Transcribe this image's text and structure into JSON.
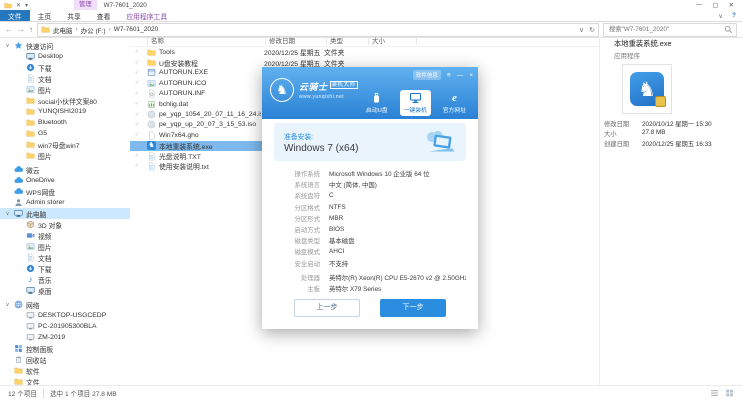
{
  "colors": {
    "accent": "#2b8de0",
    "dialog_header_top": "#60b1ef",
    "dialog_header_bottom": "#2a81d5",
    "selection_row": "#7db9ec",
    "sidebar_selection": "#cce8ff",
    "context_tab": "#f0defa",
    "folder": "#fdd36a"
  },
  "titlebar": {
    "title": "W7-7601_2020",
    "context_label": "管理",
    "controls": {
      "minimize": "—",
      "maximize": "▢",
      "close": "✕"
    }
  },
  "ribbon": {
    "tabs": [
      {
        "label": "文件",
        "style": "file"
      },
      {
        "label": "主页"
      },
      {
        "label": "共享"
      },
      {
        "label": "查看"
      },
      {
        "label": "应用程序工具",
        "style": "ctx"
      }
    ],
    "expand_glyph": "∨",
    "help_glyph": "?"
  },
  "address": {
    "back": "←",
    "forward": "→",
    "up": "↑",
    "refresh": "↻",
    "dropdown": "∨",
    "breadcrumb": [
      "此电脑",
      "办公 (F:)",
      "W7-7601_2020"
    ],
    "search_placeholder": "搜索\"W7-7601_2020\""
  },
  "sidebar": {
    "items": [
      {
        "label": "快速访问",
        "icon": "star",
        "depth": 0,
        "arrow": "expanded"
      },
      {
        "label": "Desktop",
        "icon": "monitor",
        "depth": 1
      },
      {
        "label": "下载",
        "icon": "download",
        "depth": 1
      },
      {
        "label": "文档",
        "icon": "doc",
        "depth": 1
      },
      {
        "label": "图片",
        "icon": "picture",
        "depth": 1
      },
      {
        "label": "social小伙伴文案80",
        "icon": "folder",
        "depth": 1
      },
      {
        "label": "YUNQISHI2019",
        "icon": "folder",
        "depth": 1
      },
      {
        "label": "Bluetooth",
        "icon": "folder",
        "depth": 1
      },
      {
        "label": "G5",
        "icon": "folder",
        "depth": 1
      },
      {
        "label": "win7母盘win7",
        "icon": "folder",
        "depth": 1
      },
      {
        "label": "图片",
        "icon": "folder",
        "depth": 1
      },
      {
        "label": "微云",
        "icon": "cloud",
        "depth": 0,
        "gap": true
      },
      {
        "label": "OneDrive",
        "icon": "cloud",
        "depth": 0
      },
      {
        "label": "WPS网盘",
        "icon": "cloud",
        "depth": 0
      },
      {
        "label": "Admin storer",
        "icon": "person",
        "depth": 0
      },
      {
        "label": "此电脑",
        "icon": "monitor",
        "depth": 0,
        "arrow": "expanded",
        "selected": true
      },
      {
        "label": "3D 对象",
        "icon": "cube",
        "depth": 1
      },
      {
        "label": "视频",
        "icon": "video",
        "depth": 1
      },
      {
        "label": "图片",
        "icon": "picture",
        "depth": 1
      },
      {
        "label": "文档",
        "icon": "doc",
        "depth": 1
      },
      {
        "label": "下载",
        "icon": "download",
        "depth": 1
      },
      {
        "label": "音乐",
        "icon": "music",
        "depth": 1
      },
      {
        "label": "桌面",
        "icon": "monitor",
        "depth": 1
      },
      {
        "label": "网络",
        "icon": "globe",
        "depth": 0,
        "arrow": "expanded",
        "gap": true
      },
      {
        "label": "DESKTOP-USGCEDP",
        "icon": "pc",
        "depth": 1
      },
      {
        "label": "PC-201905300BLA",
        "icon": "pc",
        "depth": 1
      },
      {
        "label": "ZM-2019",
        "icon": "pc",
        "depth": 1
      },
      {
        "label": "控制面板",
        "icon": "control",
        "depth": 0
      },
      {
        "label": "回收站",
        "icon": "trash",
        "depth": 0
      },
      {
        "label": "软件",
        "icon": "folder",
        "depth": 0
      },
      {
        "label": "文件",
        "icon": "folder",
        "depth": 0
      }
    ]
  },
  "file_list": {
    "columns": [
      "名称",
      "修改日期",
      "类型",
      "大小"
    ],
    "rows": [
      {
        "name": "Tools",
        "icon": "folder",
        "date": "2020/12/25 星期五 1...",
        "type": "文件夹",
        "size": ""
      },
      {
        "name": "U盘安装教程",
        "icon": "folder",
        "date": "2020/12/25 星期五 1...",
        "type": "文件夹",
        "size": ""
      },
      {
        "name": "AUTORUN.EXE",
        "icon": "app",
        "date": "",
        "type": "",
        "size": ""
      },
      {
        "name": "AUTORUN.ICO",
        "icon": "picture",
        "date": "",
        "type": "",
        "size": ""
      },
      {
        "name": "AUTORUN.INF",
        "icon": "inf",
        "date": "",
        "type": "",
        "size": ""
      },
      {
        "name": "bchlig.dat",
        "icon": "dat",
        "date": "",
        "type": "",
        "size": ""
      },
      {
        "name": "pe_yqp_1054_20_07_11_16_24.iso",
        "icon": "disc",
        "date": "",
        "type": "",
        "size": ""
      },
      {
        "name": "pe_yqp_up_20_07_3_15_53.iso",
        "icon": "disc",
        "date": "",
        "type": "",
        "size": ""
      },
      {
        "name": "Win7x64.gho",
        "icon": "page",
        "date": "",
        "type": "",
        "size": ""
      },
      {
        "name": "本地重装系统.exe",
        "icon": "knight",
        "date": "",
        "type": "",
        "size": "",
        "selected": true
      },
      {
        "name": "光盘说明.TXT",
        "icon": "doc",
        "date": "",
        "type": "",
        "size": ""
      },
      {
        "name": "使用安装说明.txt",
        "icon": "doc",
        "date": "",
        "type": "",
        "size": ""
      }
    ]
  },
  "details": {
    "filename": "本地重装系统.exe",
    "filetype": "应用程序",
    "rows": [
      {
        "label": "修改日期",
        "value": "2020/10/12 星期一 15:30"
      },
      {
        "label": "大小",
        "value": "27.8 MB"
      },
      {
        "label": "创建日期",
        "value": "2020/12/25 星期五 16:33"
      }
    ]
  },
  "dialog": {
    "logo": {
      "name": "云骑士",
      "suffix": "装机大师",
      "url": "www.yunqishi.net"
    },
    "info_button": "软件信息",
    "controls": {
      "menu": "≡",
      "minimize": "—",
      "close": "×"
    },
    "nav": [
      {
        "label": "启动U盘",
        "icon": "usb"
      },
      {
        "label": "一键装机",
        "icon": "machine",
        "active": true
      },
      {
        "label": "官方网址",
        "icon": "ie"
      }
    ],
    "card": {
      "title": "准备安装:",
      "os": "Windows 7 (x64)"
    },
    "specs": [
      {
        "label": "操作系统",
        "value": "Microsoft Windows 10 企业版 64 位"
      },
      {
        "label": "系统语言",
        "value": "中文 (简体, 中国)"
      },
      {
        "label": "系统盘符",
        "value": "C"
      },
      {
        "label": "分区格式",
        "value": "NTFS"
      },
      {
        "label": "分区形式",
        "value": "MBR"
      },
      {
        "label": "启动方式",
        "value": "BIOS"
      },
      {
        "label": "磁盘类型",
        "value": "基本磁盘"
      },
      {
        "label": "磁盘模式",
        "value": "AHCI"
      },
      {
        "label": "安全启动",
        "value": "不支持"
      },
      {
        "label": "处理器",
        "value": "英特尔(R) Xeon(R) CPU E5-2670 v2 @ 2.50GHz",
        "gap": true
      },
      {
        "label": "主板",
        "value": "英特尔 X79 Series"
      }
    ],
    "buttons": {
      "prev": "上一步",
      "next": "下一步"
    }
  },
  "statusbar": {
    "count": "12 个项目",
    "selection": "选中 1 个项目 27.8 MB"
  }
}
